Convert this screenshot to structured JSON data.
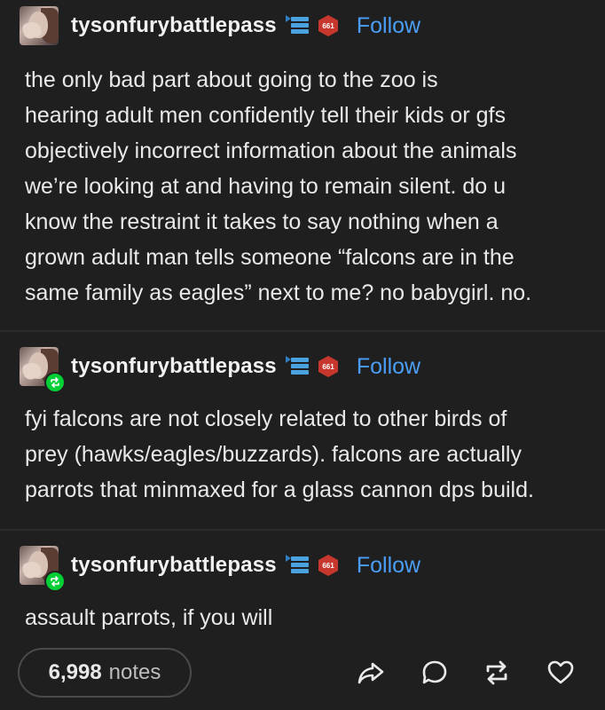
{
  "posts": [
    {
      "username": "tysonfurybattlepass",
      "follow_label": "Follow",
      "badge_text": "661",
      "reblogged": false,
      "text": "the only bad part about going to the zoo is\nhearing adult men confidently tell their kids or gfs\nobjectively incorrect information about the animals\nwe’re looking at and having to remain silent. do u\nknow the restraint it takes to say nothing when a\ngrown adult man tells someone “falcons are in the\nsame family as eagles” next to me? no babygirl. no."
    },
    {
      "username": "tysonfurybattlepass",
      "follow_label": "Follow",
      "badge_text": "661",
      "reblogged": true,
      "text": "fyi falcons are not closely related to other birds of\nprey (hawks/eagles/buzzards). falcons are actually\nparrots that minmaxed for a glass cannon dps build."
    },
    {
      "username": "tysonfurybattlepass",
      "follow_label": "Follow",
      "badge_text": "661",
      "reblogged": true,
      "text": "assault parrots, if you will"
    }
  ],
  "footer": {
    "notes_count": "6,998",
    "notes_label": "notes",
    "actions": [
      "share-icon",
      "reply-icon",
      "reblog-icon",
      "like-icon"
    ]
  },
  "colors": {
    "background": "#1f1f1f",
    "text": "#e9e9e9",
    "follow": "#4b9ef6",
    "reblog_badge": "#00cf35",
    "divider": "#2b2b2b"
  }
}
